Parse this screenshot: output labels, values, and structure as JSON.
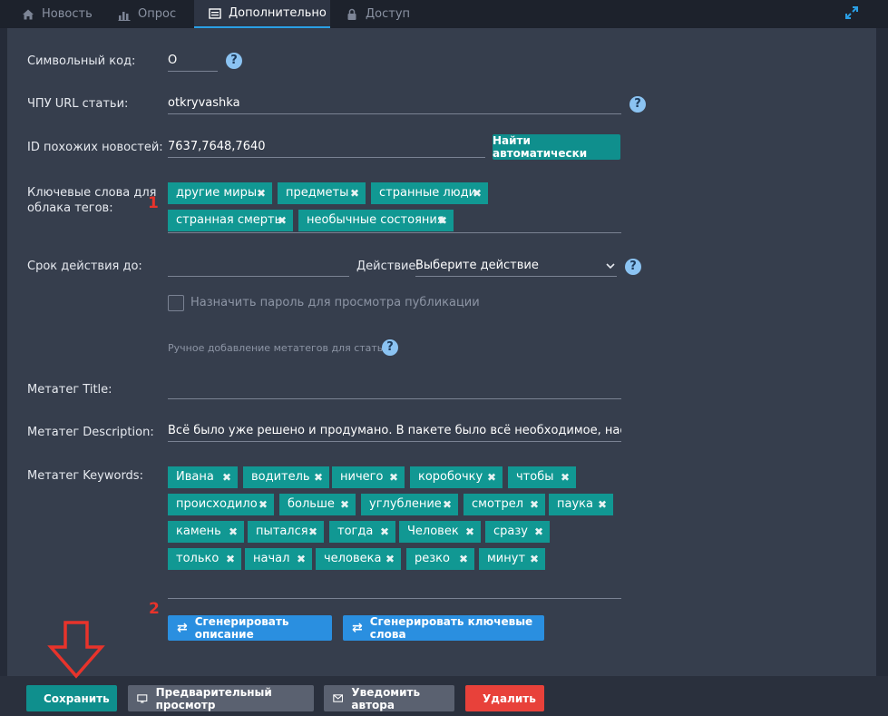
{
  "tabs": [
    {
      "label": "Новость",
      "icon": "home-icon"
    },
    {
      "label": "Опрос",
      "icon": "bar-chart-icon"
    },
    {
      "label": "Дополнительно",
      "icon": "list-icon",
      "active": true
    },
    {
      "label": "Доступ",
      "icon": "lock-icon"
    }
  ],
  "form": {
    "symbol_code": {
      "label": "Символьный код:",
      "value": "О"
    },
    "seo_url": {
      "label": "ЧПУ URL статьи:",
      "value": "otkryvashka"
    },
    "related": {
      "label": "ID похожих новостей:",
      "value": "7637,7648,7640",
      "button": "Найти автоматически"
    },
    "keywords_cloud": {
      "label_line1": "Ключевые слова для",
      "label_line2": "облака тегов:",
      "marker": "1",
      "tags": [
        "другие миры",
        "предметы",
        "странные люди",
        "странная смерть",
        "необычные состояния"
      ]
    },
    "expiry": {
      "label": "Срок действия до:",
      "value": "",
      "action_label": "Действие:",
      "action_value": "Выберите действие"
    },
    "password": {
      "label": "Назначить пароль для просмотра публикации",
      "checked": false
    },
    "manual_meta": {
      "label": "Ручное добавление метатегов для статьи"
    },
    "meta_title": {
      "label": "Метатег Title:",
      "value": ""
    },
    "meta_description": {
      "label": "Метатег Description:",
      "value": "Всё было уже решено и продумано. В пакете было всё необходимое, настроение"
    },
    "meta_keywords": {
      "label": "Метатег Keywords:",
      "tags": [
        "Ивана",
        "водитель",
        "ничего",
        "коробочку",
        "чтобы",
        "происходило",
        "больше",
        "углубление",
        "смотрел",
        "паука",
        "камень",
        "пытался",
        "тогда",
        "Человек",
        "сразу",
        "только",
        "начал",
        "человека",
        "резко",
        "минут"
      ]
    },
    "marker2": "2",
    "gen_description": "Сгенерировать описание",
    "gen_keywords": "Сгенерировать ключевые слова"
  },
  "actions": {
    "save": "Сохранить",
    "preview": "Предварительный просмотр",
    "notify": "Уведомить автора",
    "delete": "Удалить"
  },
  "colors": {
    "teal": "#119893",
    "blue": "#2a8fe0",
    "red": "#e8332b",
    "arrow": "#e8332b"
  }
}
